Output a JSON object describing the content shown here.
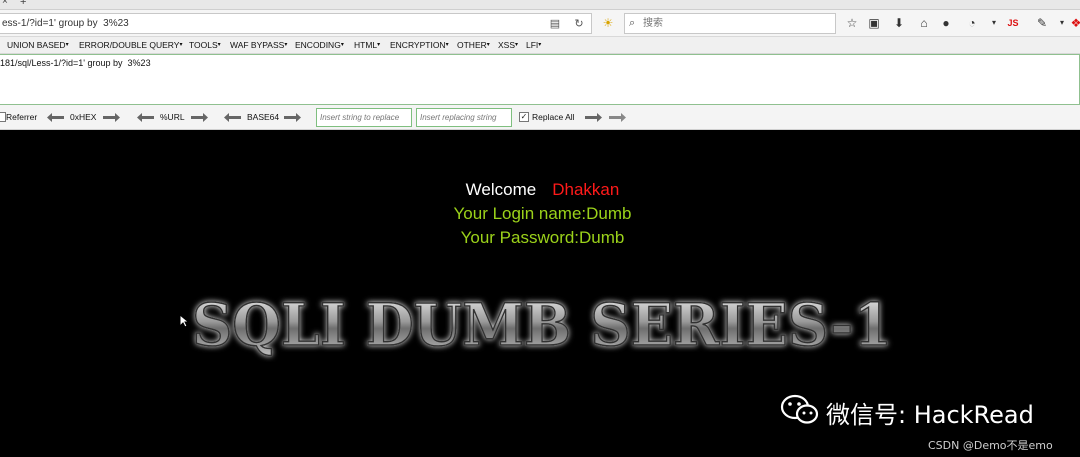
{
  "browser": {
    "url": "ess-1/?id=1' group by  3%23",
    "search_placeholder": "搜索",
    "badge_js": "JS"
  },
  "hackbar": {
    "menu": [
      "UNION BASED",
      "ERROR/DOUBLE QUERY",
      "TOOLS",
      "WAF BYPASS",
      "ENCODING",
      "HTML",
      "ENCRYPTION",
      "OTHER",
      "XSS",
      "LFI"
    ],
    "query": "181/sql/Less-1/?id=1' group by  3%23",
    "tools": {
      "referrer": "Referrer",
      "hex": "0xHEX",
      "url": "%URL",
      "base64": "BASE64",
      "replace_from_placeholder": "Insert string to replace",
      "replace_to_placeholder": "Insert replacing string",
      "replace_all": "Replace All",
      "replace_all_checked": true
    }
  },
  "page": {
    "welcome": "Welcome",
    "user": "Dhakkan",
    "login_name": "Your Login name:Dumb",
    "password": "Your Password:Dumb",
    "banner": "SQLI DUMB SERIES-1"
  },
  "watermark": {
    "wechat": "微信号: HackRead",
    "csdn": "CSDN @Demo不是emo"
  },
  "colors": {
    "background": "#000000",
    "welcome": "#ffffff",
    "user": "#ff1a1a",
    "login": "#9bd21a",
    "hackbar_border": "#8fc08f"
  }
}
